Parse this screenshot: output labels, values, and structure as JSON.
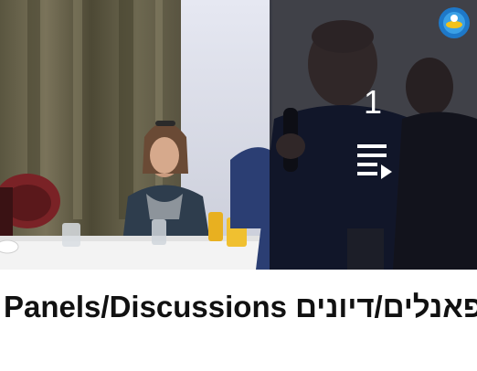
{
  "playlist": {
    "title": "Panels/Discussions פאנלים/דיונים",
    "video_count": "1",
    "overlay_icon": "playlist-play-icon",
    "channel_logo_icon": "channel-logo-icon"
  },
  "colors": {
    "overlay": "#0a0c14",
    "overlay_text": "#ffffff",
    "title_text": "#111111",
    "background": "#ffffff"
  }
}
